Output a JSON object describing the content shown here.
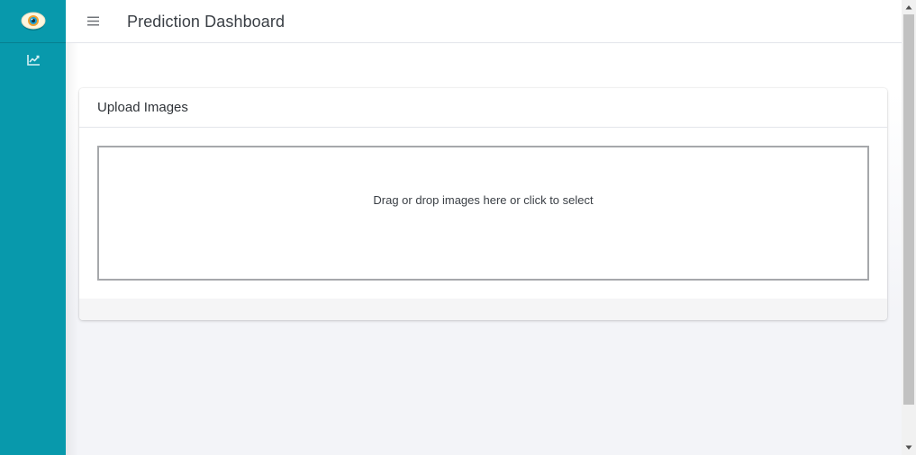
{
  "sidebar": {
    "logo_icon": "eye-icon",
    "items": [
      {
        "icon": "chart-line-icon",
        "label": ""
      }
    ],
    "color": "#0899ac"
  },
  "header": {
    "menu_icon": "hamburger-menu-icon",
    "title": "Prediction Dashboard"
  },
  "card": {
    "title": "Upload Images",
    "dropzone_text": "Drag or drop images here or click to select"
  },
  "scrollbar": {
    "up_icon": "triangle-up-icon",
    "down_icon": "triangle-down-icon"
  }
}
